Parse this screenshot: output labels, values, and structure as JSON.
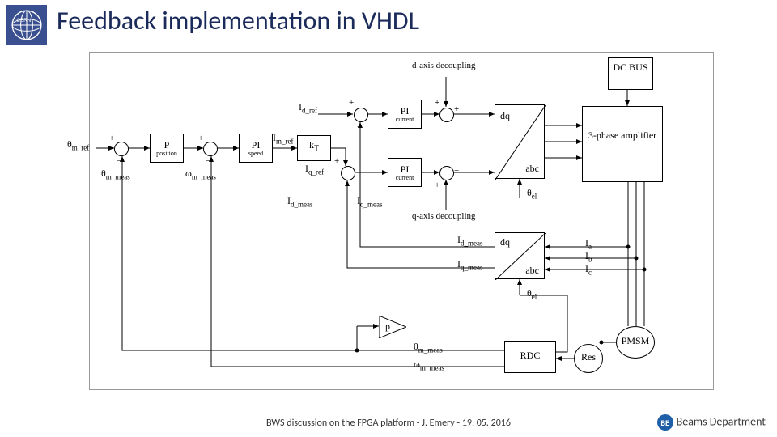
{
  "header": {
    "title": "Feedback implementation in VHDL"
  },
  "footer": {
    "center": "BWS discussion on the FPGA platform - J. Emery - 19. 05. 2016",
    "right_badge": "BE",
    "right_label": "Beams Department"
  },
  "blocks": {
    "p_position": {
      "main": "P",
      "sub": "position"
    },
    "pi_speed": {
      "main": "PI",
      "sub": "speed"
    },
    "kt": {
      "main": "k",
      "sub": "T"
    },
    "pi_current_d": {
      "main": "PI",
      "sub": "current"
    },
    "pi_current_q": {
      "main": "PI",
      "sub": "current"
    },
    "dq_abc": {
      "top": "dq",
      "bot": "abc"
    },
    "abc_dq": {
      "top": "dq",
      "bot": "abc"
    },
    "amp": {
      "main": "3-phase amplifier"
    },
    "dcbus": {
      "main": "DC BUS"
    },
    "pmsm": {
      "main": "PMSM"
    },
    "res": {
      "main": "Res"
    },
    "rdc": {
      "main": "RDC"
    },
    "p_deriv": {
      "main": "p"
    }
  },
  "labels": {
    "theta_m_ref": "θ_m_ref",
    "theta_m_meas": "θ_m_meas",
    "omega_m_meas_fb": "ω_m_meas",
    "Im_ref": "I_m_ref",
    "Id_ref": "I_d_ref",
    "Iq_ref": "I_q_ref",
    "Id_meas": "I_d_meas",
    "Iq_meas": "I_q_meas",
    "d_decoupling": "d-axis decoupling",
    "q_decoupling": "q-axis decoupling",
    "theta_el_top": "θ_el",
    "theta_el_bot": "θ_el",
    "Id_meas_out": "I_d_meas",
    "Iq_meas_out": "I_q_meas",
    "Ia": "I_a",
    "Ib": "I_b",
    "Ic": "I_c",
    "theta_m_meas_out": "θ_m_meas",
    "omega_m_meas_out": "ω_m_meas"
  }
}
